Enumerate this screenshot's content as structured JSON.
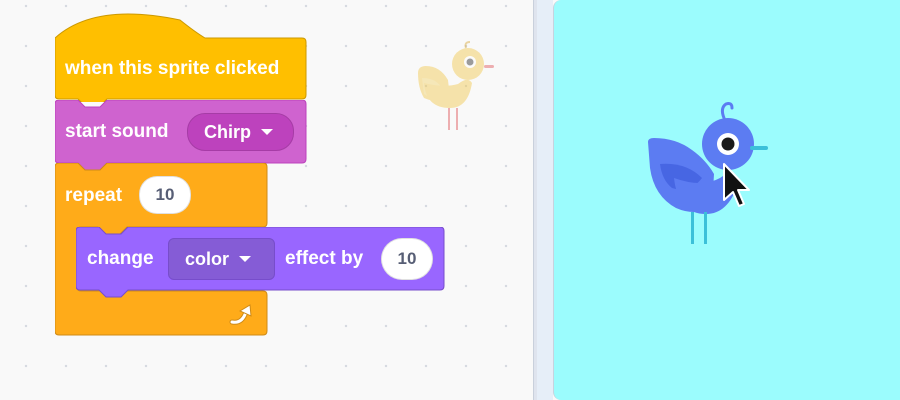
{
  "blocks": {
    "hat": {
      "label": "when this sprite clicked"
    },
    "sound": {
      "label": "start sound",
      "dropdown_value": "Chirp"
    },
    "repeat": {
      "label": "repeat",
      "count": "10"
    },
    "effect": {
      "label_before": "change",
      "dropdown_value": "color",
      "label_after": "effect by",
      "amount": "10"
    }
  },
  "icons": {
    "loop_arrow": "loop-arrow-icon",
    "sprite_thumbnail": "bird-sprite-icon",
    "stage_sprite": "bird-sprite-icon",
    "cursor": "mouse-pointer-icon"
  },
  "colors": {
    "events": "#ffbf00",
    "sound": "#cf63cf",
    "control": "#ffab19",
    "looks": "#9966ff",
    "stage_background": "#9bfcfd",
    "bird_body": "#5c7cf2"
  }
}
